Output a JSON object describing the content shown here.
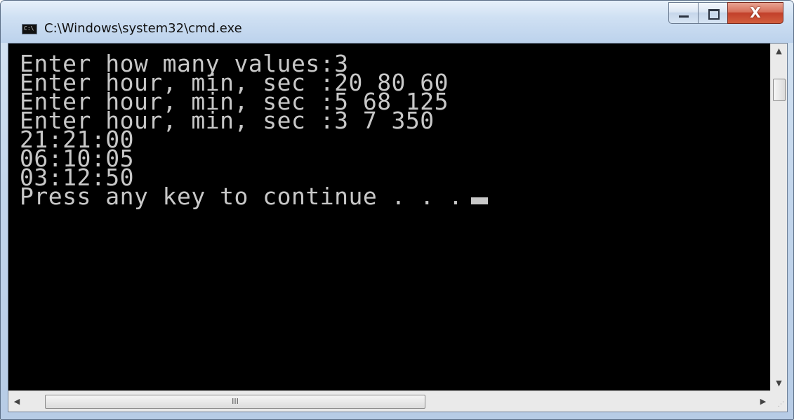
{
  "window": {
    "title": "C:\\Windows\\system32\\cmd.exe",
    "icon": "cmd-icon",
    "icon_glyph": "C:\\",
    "buttons": {
      "minimize_icon": "minimize-icon",
      "maximize_icon": "maximize-icon",
      "close_icon": "close-icon",
      "close_glyph": "X"
    }
  },
  "console": {
    "lines": [
      "Enter how many values:3",
      "Enter hour, min, sec :20 80 60",
      "Enter hour, min, sec :5 68 125",
      "Enter hour, min, sec :3 7 350",
      "21:21:00",
      "06:10:05",
      "03:12:50",
      "Press any key to continue . . ."
    ],
    "colors": {
      "background": "#000000",
      "text": "#c8c8c8"
    }
  },
  "scrollbars": {
    "horizontal_grip": "III",
    "up_arrow": "▲",
    "down_arrow": "▼",
    "left_arrow": "◀",
    "right_arrow": "▶"
  }
}
